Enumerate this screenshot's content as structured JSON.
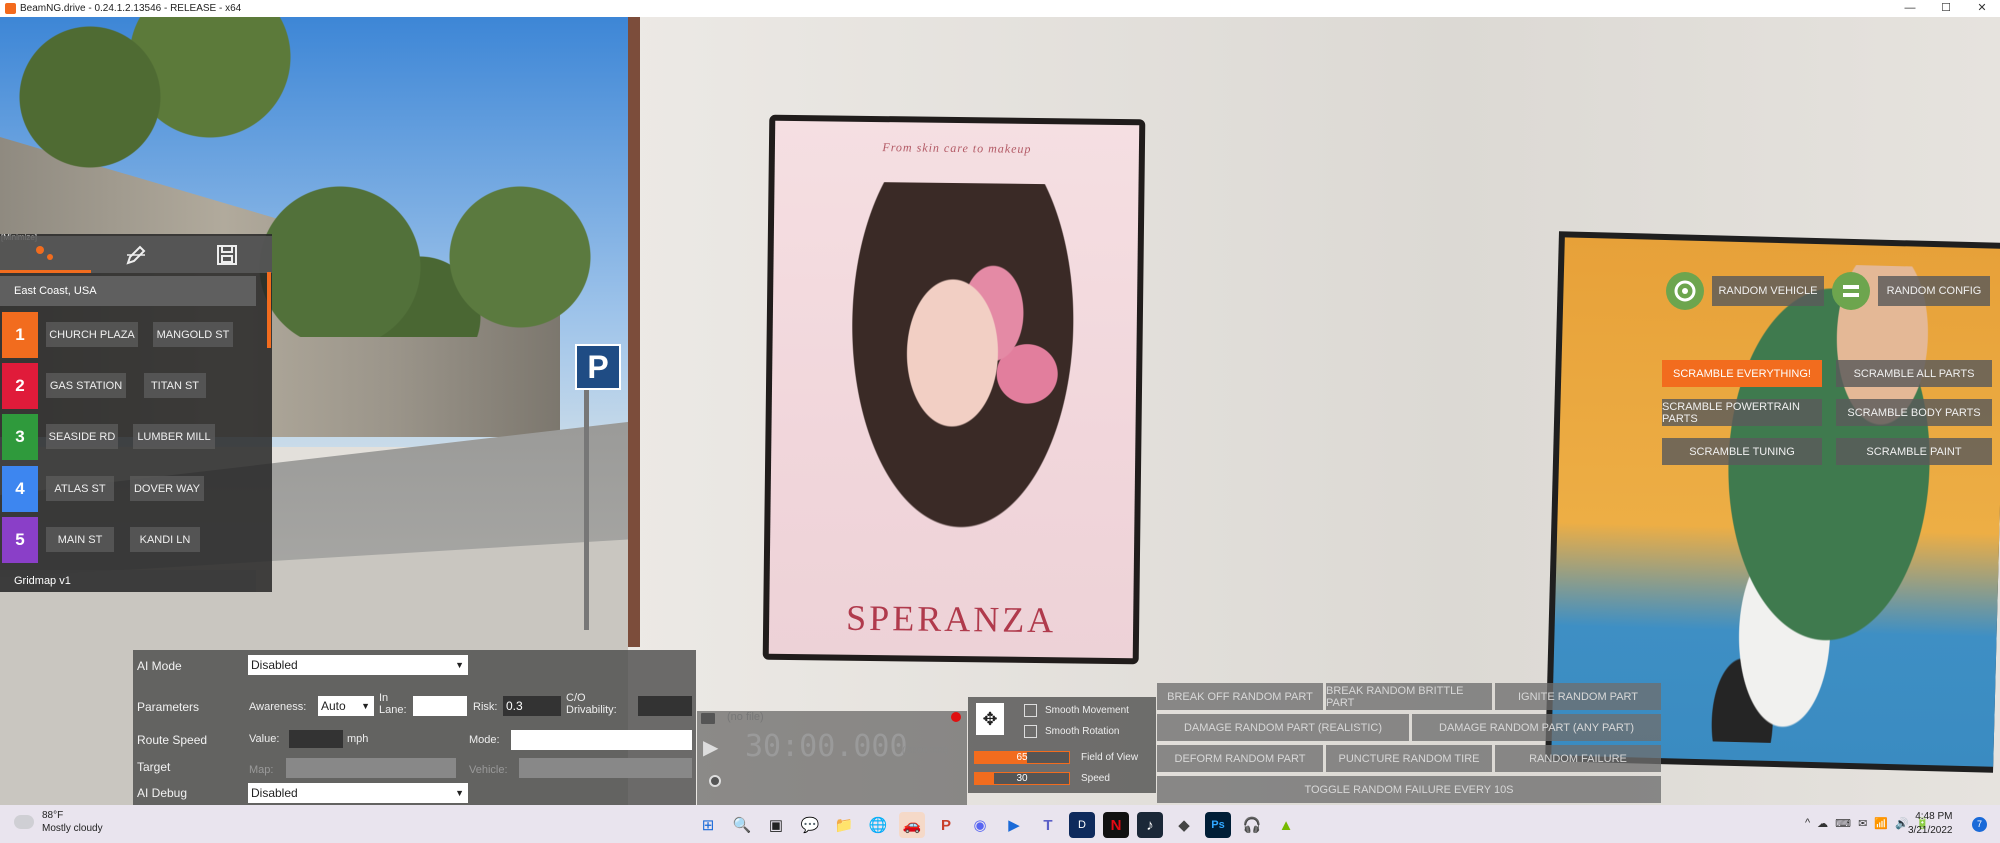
{
  "window": {
    "title": "BeamNG.drive - 0.24.1.2.13546 - RELEASE - x64",
    "controls": [
      "—",
      "☐",
      "✕"
    ]
  },
  "poster": {
    "tagline": "From skin care to makeup",
    "brand": "SPERANZA"
  },
  "parking_sign": "P",
  "quick_travel": {
    "minimize_label": "[Minimize]",
    "location": "East Coast, USA",
    "rows": [
      {
        "num": "1",
        "color": "#f26c1e",
        "a": "CHURCH PLAZA",
        "b": "MANGOLD ST"
      },
      {
        "num": "2",
        "color": "#e01b3a",
        "a": "GAS STATION",
        "b": "TITAN ST"
      },
      {
        "num": "3",
        "color": "#2f9a3c",
        "a": "SEASIDE RD",
        "b": "LUMBER MILL"
      },
      {
        "num": "4",
        "color": "#3d86f0",
        "a": "ATLAS ST",
        "b": "DOVER WAY"
      },
      {
        "num": "5",
        "color": "#8a3fc8",
        "a": "MAIN ST",
        "b": "KANDI LN"
      }
    ],
    "footer": "Gridmap v1"
  },
  "random_vehicle": {
    "random_vehicle": "RANDOM VEHICLE",
    "random_config": "RANDOM CONFIG",
    "scramble_everything": "SCRAMBLE EVERYTHING!",
    "scramble_all_parts": "SCRAMBLE ALL PARTS",
    "scramble_powertrain": "SCRAMBLE POWERTRAIN PARTS",
    "scramble_body": "SCRAMBLE BODY PARTS",
    "scramble_tuning": "SCRAMBLE TUNING",
    "scramble_paint": "SCRAMBLE PAINT"
  },
  "failures": {
    "break_off": "BREAK OFF RANDOM PART",
    "break_brittle": "BREAK RANDOM BRITTLE PART",
    "ignite": "IGNITE RANDOM PART",
    "damage_realistic": "DAMAGE RANDOM PART (REALISTIC)",
    "damage_any": "DAMAGE RANDOM PART (ANY PART)",
    "deform": "DEFORM RANDOM PART",
    "puncture": "PUNCTURE RANDOM TIRE",
    "random_failure": "RANDOM FAILURE",
    "toggle_failure": "TOGGLE RANDOM FAILURE EVERY 10S"
  },
  "ai": {
    "mode_label": "AI Mode",
    "mode_value": "Disabled",
    "parameters_label": "Parameters",
    "awareness_label": "Awareness:",
    "awareness_value": "Auto",
    "in_lane_label": "In Lane:",
    "risk_label": "Risk:",
    "risk_value": "0.3",
    "co_drivability_label": "C/O Drivability:",
    "route_speed_label": "Route Speed",
    "value_label": "Value:",
    "mph_label": "mph",
    "route_mode_label": "Mode:",
    "target_label": "Target",
    "map_label": "Map:",
    "vehicle_label": "Vehicle:",
    "debug_label": "AI Debug",
    "debug_value": "Disabled"
  },
  "replay": {
    "file": "(no file)",
    "time": "30:00.000",
    "time_small": "(30:00.000)"
  },
  "camera": {
    "smooth_movement": "Smooth Movement",
    "smooth_rotation": "Smooth Rotation",
    "fov_label": "Field of View",
    "fov_value": "65",
    "fov_fill": 0.55,
    "speed_label": "Speed",
    "speed_value": "30",
    "speed_fill": 0.2
  },
  "taskbar": {
    "temp": "88°F",
    "condition": "Mostly cloudy",
    "time": "4:48 PM",
    "date": "3/21/2022",
    "notifications": "7",
    "tray_icons": [
      "^",
      "☁",
      "⌨",
      "✉",
      "📶",
      "🔊",
      "🔋"
    ],
    "apps": [
      "⊞",
      "🔍",
      "▣",
      "💬",
      "📁",
      "🌐",
      "🚗",
      "P",
      "◉",
      "▶",
      "T",
      "D",
      "N",
      "♪",
      "◆",
      "Ps",
      "🎧",
      "▲"
    ]
  }
}
